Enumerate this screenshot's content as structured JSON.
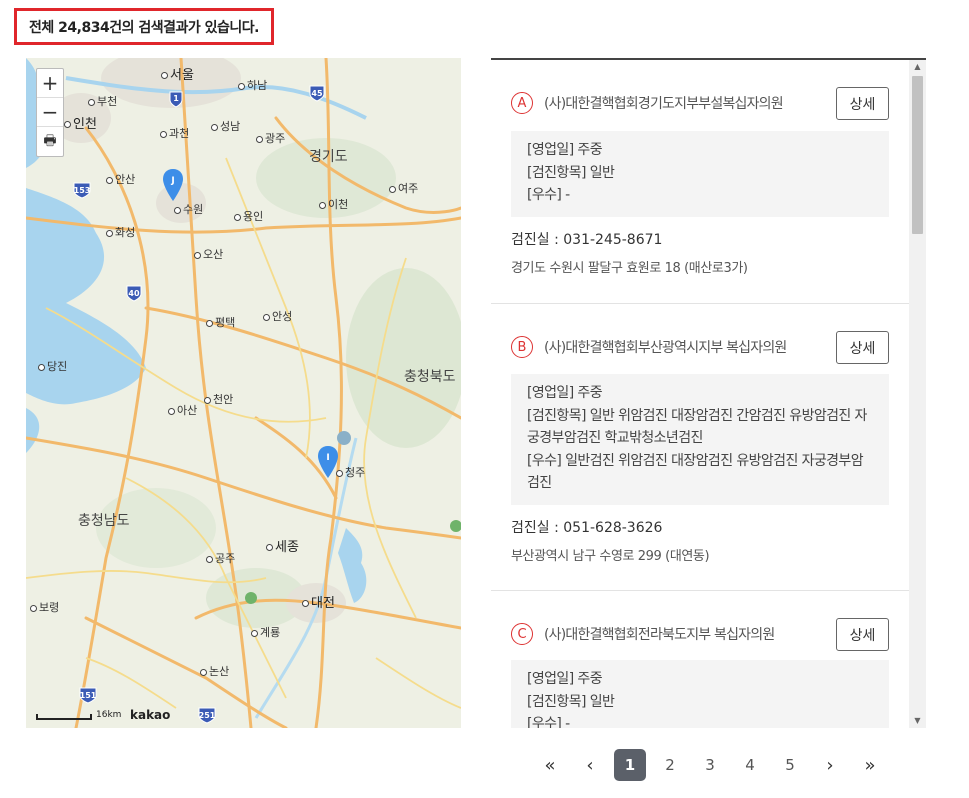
{
  "summary": {
    "text": "전체 24,834건의 검색결과가 있습니다."
  },
  "map": {
    "zoom_in": "+",
    "zoom_out": "−",
    "print": "🖶",
    "scale_label": "16km",
    "brand": "kakao",
    "labels": [
      {
        "text": "서울",
        "kind": "city"
      },
      {
        "text": "하남",
        "kind": "town"
      },
      {
        "text": "부천",
        "kind": "town"
      },
      {
        "text": "인천",
        "kind": "city"
      },
      {
        "text": "과천",
        "kind": "town"
      },
      {
        "text": "성남",
        "kind": "town"
      },
      {
        "text": "광주",
        "kind": "town"
      },
      {
        "text": "경기도",
        "kind": "region"
      },
      {
        "text": "안산",
        "kind": "town"
      },
      {
        "text": "수원",
        "kind": "town"
      },
      {
        "text": "용인",
        "kind": "town"
      },
      {
        "text": "이천",
        "kind": "town"
      },
      {
        "text": "여주",
        "kind": "town"
      },
      {
        "text": "화성",
        "kind": "town"
      },
      {
        "text": "오산",
        "kind": "town"
      },
      {
        "text": "평택",
        "kind": "town"
      },
      {
        "text": "안성",
        "kind": "town"
      },
      {
        "text": "당진",
        "kind": "town"
      },
      {
        "text": "충청북도",
        "kind": "region"
      },
      {
        "text": "천안",
        "kind": "town"
      },
      {
        "text": "아산",
        "kind": "town"
      },
      {
        "text": "청주",
        "kind": "town"
      },
      {
        "text": "충청남도",
        "kind": "region"
      },
      {
        "text": "세종",
        "kind": "city"
      },
      {
        "text": "공주",
        "kind": "town"
      },
      {
        "text": "대전",
        "kind": "city"
      },
      {
        "text": "보령",
        "kind": "town"
      },
      {
        "text": "계룡",
        "kind": "town"
      },
      {
        "text": "논산",
        "kind": "town"
      }
    ],
    "road_shields": [
      "1",
      "45",
      "153",
      "40",
      "151",
      "251"
    ],
    "marker_labels": [
      "J",
      "I"
    ]
  },
  "results": [
    {
      "letter": "A",
      "name": "(사)대한결핵협회경기도지부부설복십자의원",
      "detail_label": "상세",
      "lines": [
        "[영업일] 주중",
        "[검진항목] 일반",
        "[우수] -"
      ],
      "tel": "검진실 :  031-245-8671",
      "address": "경기도 수원시 팔달구 효원로 18 (매산로3가)"
    },
    {
      "letter": "B",
      "name": "(사)대한결핵협회부산광역시지부 복십자의원",
      "detail_label": "상세",
      "lines": [
        "[영업일] 주중",
        "[검진항목] 일반 위암검진 대장암검진 간암검진 유방암검진 자궁경부암검진 학교밖청소년검진",
        "[우수] 일반검진 위암검진 대장암검진 유방암검진 자궁경부암검진"
      ],
      "tel": "검진실 :  051-628-3626",
      "address": "부산광역시 남구 수영로 299 (대연동)"
    },
    {
      "letter": "C",
      "name": "(사)대한결핵협회전라북도지부 복십자의원",
      "detail_label": "상세",
      "lines": [
        "[영업일] 주중",
        "[검진항목] 일반",
        "[우수] -"
      ],
      "tel": "",
      "address": ""
    }
  ],
  "pagination": {
    "first": "«",
    "prev": "‹",
    "pages": [
      "1",
      "2",
      "3",
      "4",
      "5"
    ],
    "current": "1",
    "next": "›",
    "last": "»"
  }
}
